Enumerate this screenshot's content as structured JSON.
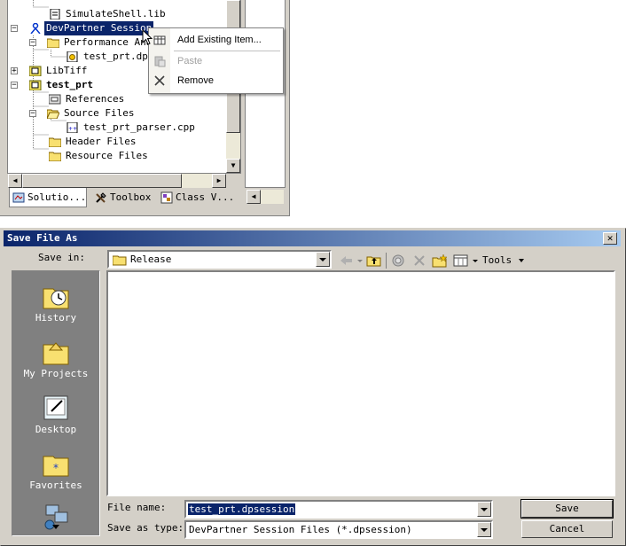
{
  "tree": {
    "items": [
      {
        "label": "SimulateShell.lib"
      },
      {
        "label": "DevPartner Session"
      },
      {
        "label": "Performance Anal"
      },
      {
        "label": "test_prt.dpse"
      },
      {
        "label": "LibTiff"
      },
      {
        "label": "test_prt"
      },
      {
        "label": "References"
      },
      {
        "label": "Source Files"
      },
      {
        "label": "test_prt_parser.cpp"
      },
      {
        "label": "Header Files"
      },
      {
        "label": "Resource Files"
      }
    ]
  },
  "tabs": [
    {
      "label": "Solutio..."
    },
    {
      "label": "Toolbox"
    },
    {
      "label": "Class V..."
    }
  ],
  "context_menu": {
    "add_existing": "Add Existing Item...",
    "paste": "Paste",
    "remove": "Remove"
  },
  "dialog": {
    "title": "Save File As",
    "save_in_label": "Save in:",
    "save_in_value": "Release",
    "tools_label": "Tools",
    "places": [
      {
        "label": "History",
        "icon": "history-icon"
      },
      {
        "label": "My Projects",
        "icon": "my-projects-icon"
      },
      {
        "label": "Desktop",
        "icon": "desktop-icon"
      },
      {
        "label": "Favorites",
        "icon": "favorites-icon"
      }
    ],
    "file_name_label": "File name:",
    "file_name_value": "test_prt.dpsession",
    "save_type_label": "Save as type:",
    "save_type_value": "DevPartner Session Files (*.dpsession)",
    "save_button": "Save",
    "cancel_button": "Cancel"
  },
  "colors": {
    "selection": "#0a246a",
    "face": "#d4d0c8",
    "title_gradient_end": "#a6caf0"
  }
}
